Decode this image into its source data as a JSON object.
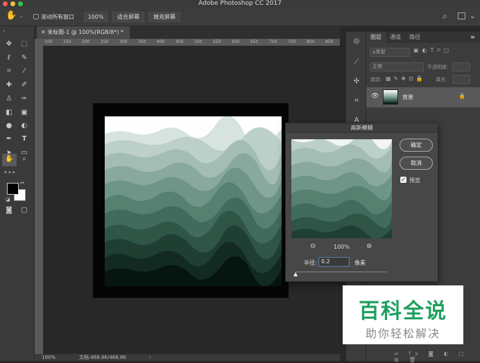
{
  "app": {
    "title": "Adobe Photoshop CC 2017"
  },
  "options": {
    "scroll_all_label": "滚动所有窗口",
    "zoom100_label": "100%",
    "fit_screen_label": "适合屏幕",
    "fill_screen_label": "填充屏幕"
  },
  "document": {
    "tab_label": "未标题-1 @ 100%(RGB/8*) *",
    "ruler_marks": [
      "100",
      "150",
      "200",
      "250",
      "300",
      "350",
      "400",
      "450",
      "500",
      "550",
      "600",
      "650",
      "700",
      "750",
      "800",
      "850"
    ]
  },
  "status": {
    "zoom": "100%",
    "doc_size": "文档:468.8K/468.8K",
    "arrow": "›"
  },
  "layers_panel": {
    "tabs": [
      "图层",
      "通道",
      "路径"
    ],
    "kind_placeholder": "ρ类型",
    "blend_mode": "正常",
    "opacity_label": "不透明度:",
    "lock_label": "锁定:",
    "fill_label": "填充:",
    "layer_name": "背景"
  },
  "dialog": {
    "title": "高斯模糊",
    "ok": "确定",
    "cancel": "取消",
    "preview_label": "预览",
    "preview_checked": true,
    "zoom": "100%",
    "radius_label": "半径:",
    "radius_value": "0.2",
    "unit": "像素"
  },
  "watermark": {
    "title": "百科全说",
    "subtitle": "助你轻松解决",
    "color": "#1fa05f"
  }
}
